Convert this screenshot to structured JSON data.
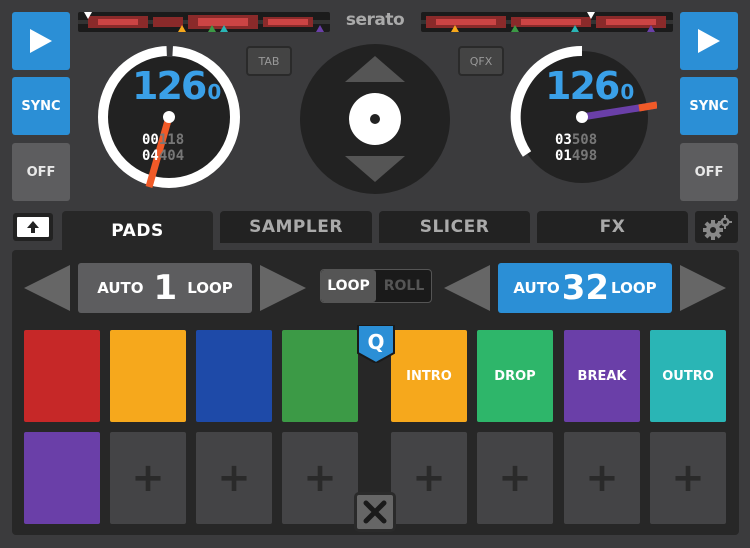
{
  "app": {
    "logo": "serato"
  },
  "deck_left": {
    "play_label": "play",
    "sync_label": "SYNC",
    "off_label": "OFF",
    "bpm_main": "126",
    "bpm_decimal": "0",
    "elapsed_bright": "00",
    "elapsed_dim": "18",
    "elapsed_prefix_dim": "1",
    "remain_bright": "04",
    "remain_mid": "40",
    "remain_dim": "4"
  },
  "deck_right": {
    "play_label": "play",
    "sync_label": "SYNC",
    "off_label": "OFF",
    "bpm_main": "126",
    "bpm_decimal": "0",
    "elapsed_bright": "03",
    "elapsed_mid": "50",
    "elapsed_dim": "8",
    "remain_bright": "01",
    "remain_mid": "49",
    "remain_dim": "8"
  },
  "center": {
    "tab_label": "TAB",
    "qfx_label": "QFX"
  },
  "tabs": [
    {
      "label": "PADS",
      "active": true
    },
    {
      "label": "SAMPLER",
      "active": false
    },
    {
      "label": "SLICER",
      "active": false
    },
    {
      "label": "FX",
      "active": false
    }
  ],
  "loop_left": {
    "prefix": "AUTO",
    "value": "1",
    "suffix": "LOOP"
  },
  "loop_right": {
    "prefix": "AUTO",
    "value": "32",
    "suffix": "LOOP"
  },
  "mode_toggle": {
    "on": "LOOP",
    "off": "ROLL"
  },
  "quantize_label": "Q",
  "pads_left": [
    {
      "color": "#c62828",
      "label": ""
    },
    {
      "color": "#f6a81c",
      "label": ""
    },
    {
      "color": "#1e4aa8",
      "label": ""
    },
    {
      "color": "#3c9a46",
      "label": ""
    },
    {
      "color": "#6a3fa8",
      "label": ""
    },
    {
      "color": "",
      "label": "+"
    },
    {
      "color": "",
      "label": "+"
    },
    {
      "color": "",
      "label": "+"
    }
  ],
  "pads_right": [
    {
      "color": "#f6a81c",
      "label": "INTRO"
    },
    {
      "color": "#2eb66a",
      "label": "DROP"
    },
    {
      "color": "#6a3fa8",
      "label": "BREAK"
    },
    {
      "color": "#2ab5b5",
      "label": "OUTRO"
    },
    {
      "color": "",
      "label": "+"
    },
    {
      "color": "",
      "label": "+"
    },
    {
      "color": "",
      "label": "+"
    },
    {
      "color": "",
      "label": "+"
    }
  ],
  "colors": {
    "accent_blue": "#2b8fd6",
    "bpm_blue": "#3aa0e8",
    "needle_orange": "#f05a28",
    "needle_purple": "#6a3fa8"
  }
}
